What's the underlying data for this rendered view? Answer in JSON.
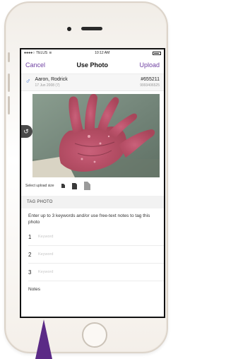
{
  "status_bar": {
    "carrier": "TELUS",
    "time": "10:12 AM"
  },
  "nav": {
    "cancel_label": "Cancel",
    "title": "Use Photo",
    "upload_label": "Upload"
  },
  "patient": {
    "gender_symbol": "♂",
    "name": "Aaron, Rodrick",
    "dob": "17 Jun 2008 (7)",
    "id": "#655211",
    "phone": "9993406525"
  },
  "photo": {
    "rotate_symbol": "↺"
  },
  "upload_size": {
    "label": "Select upload size"
  },
  "tag_section": {
    "header": "TAG PHOTO",
    "hint": "Enter up to 3 keywords and/or use free-text notes to tag this photo",
    "keywords": [
      {
        "num": "1",
        "placeholder": "Keyword"
      },
      {
        "num": "2",
        "placeholder": "Keyword"
      },
      {
        "num": "3",
        "placeholder": "Keyword"
      }
    ],
    "notes_label": "Notes"
  },
  "colors": {
    "accent": "#6e3fa1",
    "gender_male": "#3b6fd0",
    "brand_triangle": "#5b2a86"
  }
}
